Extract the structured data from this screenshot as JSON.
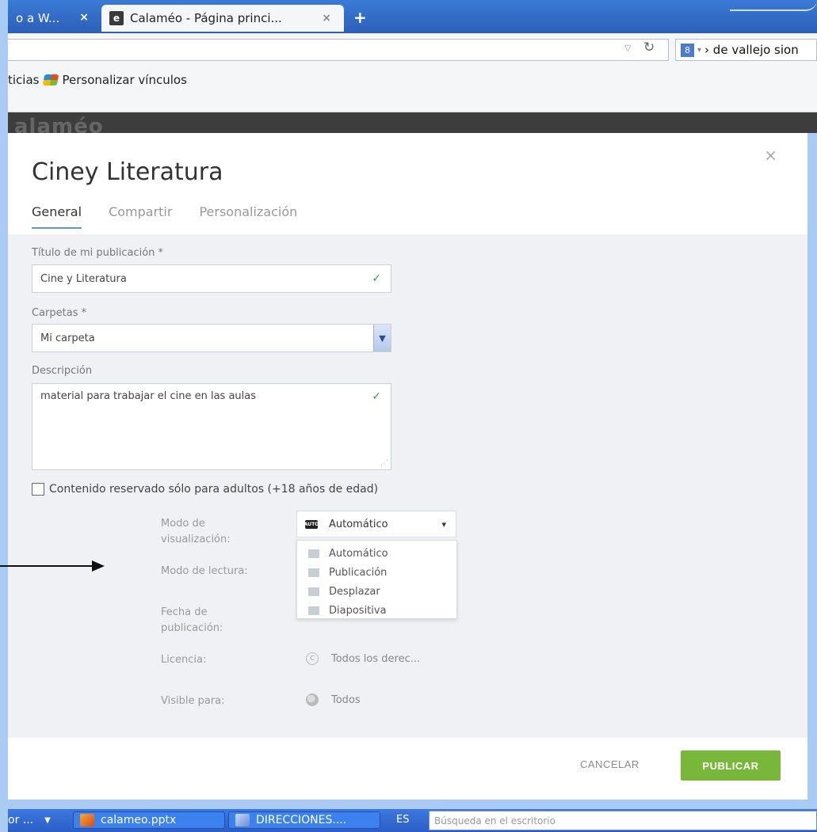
{
  "browser": {
    "tabs": [
      {
        "label": "o a W...",
        "active": false
      },
      {
        "label": "Calaméo - Página princi...",
        "active": true
      }
    ],
    "tab_close_glyph": "×",
    "new_tab_glyph": "+",
    "favicon_letter": "e",
    "search_engine_letter": "8",
    "search_value": "› de vallejo sion",
    "bookmarks": [
      "ticias",
      "Personalizar vínculos"
    ],
    "site_logo": "alaméo"
  },
  "modal": {
    "title": "Ciney Literatura",
    "close_glyph": "×",
    "tabs": [
      "General",
      "Compartir",
      "Personalización"
    ],
    "active_tab": "General",
    "title_field": {
      "label": "Título de mi publicación *",
      "value": "Cine y Literatura"
    },
    "folder_field": {
      "label": "Carpetas *",
      "value": "Mi carpeta"
    },
    "description_field": {
      "label": "Descripción",
      "value": "material para trabajar el cine en las aulas"
    },
    "adult_checkbox": {
      "label": "Contenido reservado sólo para adultos (+18 años de edad)",
      "checked": false
    },
    "display_mode": {
      "label": "Modo de visualización:",
      "selected": "Automático",
      "options": [
        "Automático",
        "Publicación",
        "Desplazar",
        "Diapositiva"
      ]
    },
    "reading_mode": {
      "label": "Modo de lectura:"
    },
    "publish_date": {
      "label": "Fecha de publicación:"
    },
    "license": {
      "label": "Licencia:",
      "value": "Todos los derec..."
    },
    "visible_to": {
      "label": "Visible para:",
      "value": "Todos"
    },
    "buttons": {
      "cancel": "CANCELAR",
      "publish": "PUBLICAR"
    }
  },
  "taskbar": {
    "first_item": "or ...",
    "items": [
      "calameo.pptx",
      "DIRECCIONES...."
    ],
    "language": "ES",
    "search_placeholder": "Búsqueda en el escritorio"
  },
  "colors": {
    "accent": "#5c95d4",
    "publish_button": "#79b73a",
    "check_ok": "#3a9d3a",
    "outer_frame": "#a9cbf4"
  }
}
